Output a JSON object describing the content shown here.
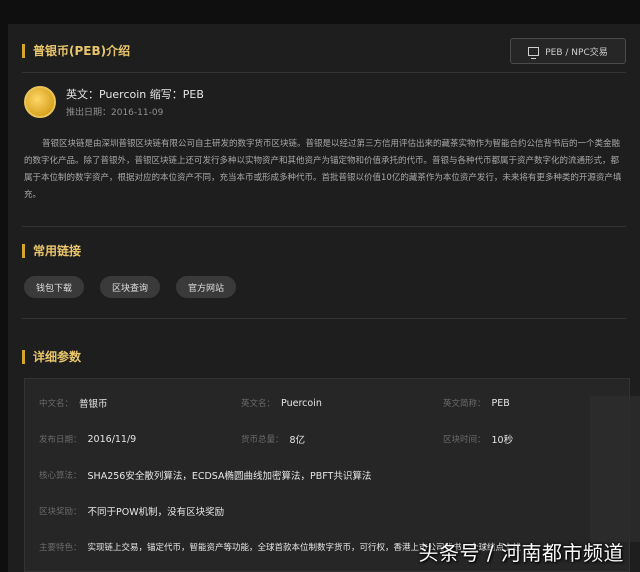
{
  "intro": {
    "title": "普银币(PEB)介绍",
    "trade_button": "PEB / NPC交易",
    "coin_name": "英文：Puercoin 缩写：PEB",
    "issue_date": "推出日期：2016-11-09",
    "description": "普银区块链是由深圳普银区块链有限公司自主研发的数字货币区块链。普银是以经过第三方信用评估出来的藏茶实物作为智能合约公信背书后的一个类金融的数字化产品。除了普银外，普银区块链上还可发行多种以实物资产和其他资产为锚定物和价值承托的代币。普银与各种代币都属于资产数字化的流通形式，都属于本位制的数字资产，根据对应的本位资产不同，充当本币或形成多种代币。首批普银以价值10亿的藏茶作为本位资产发行，未来将有更多种类的开源资产填充。"
  },
  "links": {
    "title": "常用链接",
    "items": [
      "钱包下载",
      "区块查询",
      "官方网站"
    ]
  },
  "params": {
    "title": "详细参数",
    "cn_name_label": "中文名：",
    "cn_name": "普银币",
    "en_name_label": "英文名：",
    "en_name": "Puercoin",
    "abbr_label": "英文简称：",
    "abbr": "PEB",
    "issue_label": "发布日期：",
    "issue": "2016/11/9",
    "total_label": "货币总量：",
    "total": "8亿",
    "block_label": "区块时间：",
    "block": "10秒",
    "algo_label": "核心算法：",
    "algo": "SHA256安全散列算法，ECDSA椭圆曲线加密算法，PBFT共识算法",
    "reward_label": "区块奖励：",
    "reward": "不同于POW机制，没有区块奖励",
    "features_label": "主要特色：",
    "features": "实现链上交易，锚定代币，智能资产等功能，全球首款本位制数字货币，可行权，香港上市公司背书，全球结点上线"
  },
  "watermark": "头条号 / 河南都市频道",
  "colors": {
    "accent": "#d4a62a",
    "title": "#e8c56a",
    "panel": "#1e1e1e"
  }
}
